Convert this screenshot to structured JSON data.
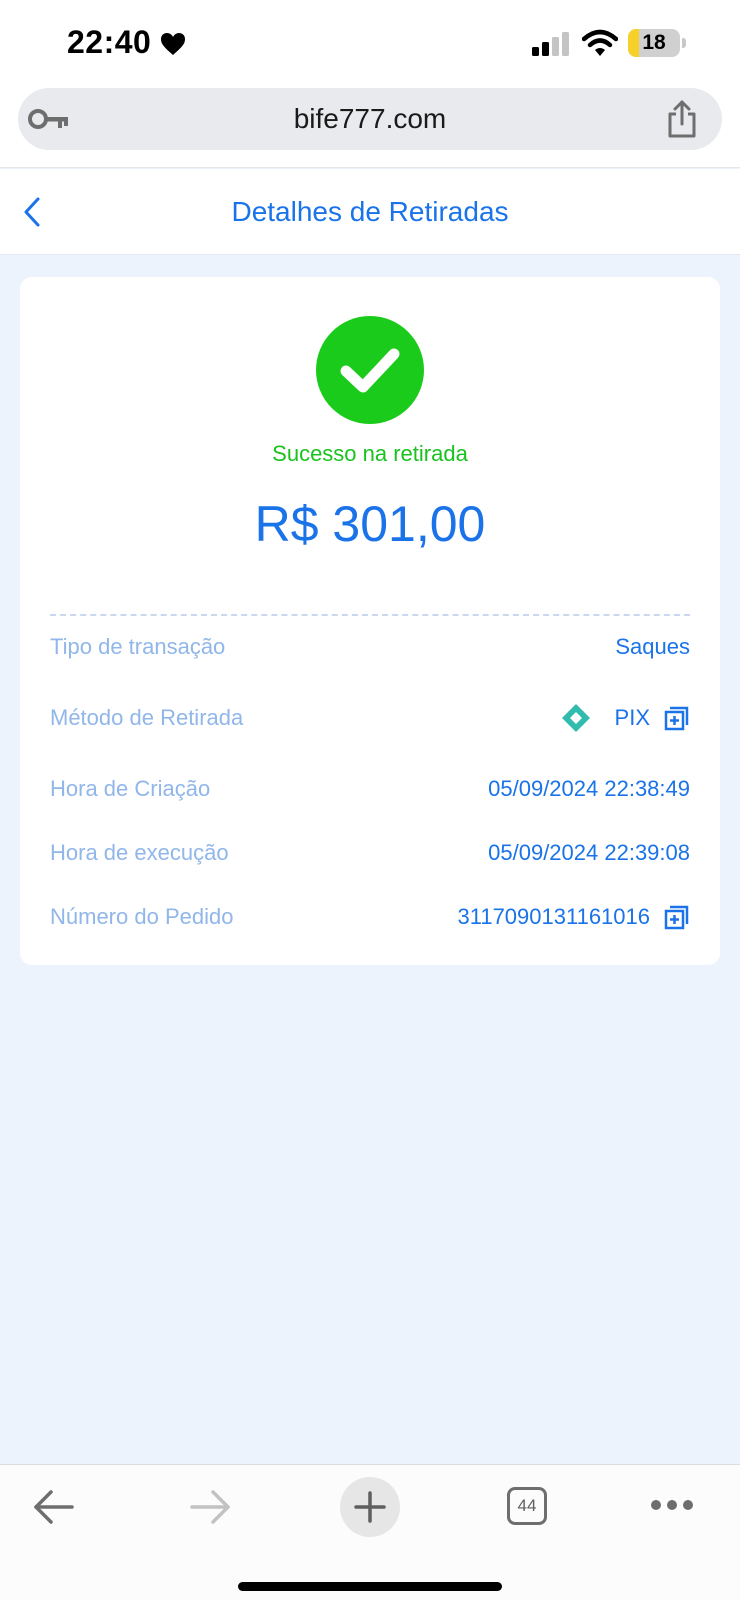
{
  "status_bar": {
    "time": "22:40",
    "battery_level": "18",
    "icons": [
      "heart-icon",
      "cellular-signal-icon",
      "wifi-icon",
      "battery-icon"
    ]
  },
  "browser": {
    "url": "bife777.com",
    "icons": [
      "key-icon",
      "share-icon"
    ]
  },
  "header": {
    "title": "Detalhes de Retiradas",
    "back_icon": "chevron-left-icon"
  },
  "card": {
    "status": "Sucesso na retirada",
    "amount": "R$ 301,00",
    "status_icon": "check-circle-icon",
    "rows": [
      {
        "label": "Tipo de transação",
        "value": "Saques"
      },
      {
        "label": "Método de Retirada",
        "value": "PIX"
      },
      {
        "label": "Hora de Criação",
        "value": "05/09/2024 22:38:49"
      },
      {
        "label": "Hora de execução",
        "value": "05/09/2024 22:39:08"
      },
      {
        "label": "Número do Pedido",
        "value": "3117090131161016"
      }
    ]
  },
  "toolbar": {
    "tab_count": "44",
    "icons": [
      "arrow-left-icon",
      "arrow-right-icon",
      "plus-icon",
      "tabs-icon",
      "more-icon"
    ]
  },
  "colors": {
    "accent": "#1a73e8",
    "success": "#19c21e",
    "label": "#90b6ea",
    "page_background": "#edf3fc",
    "pix": "#32bcad"
  }
}
